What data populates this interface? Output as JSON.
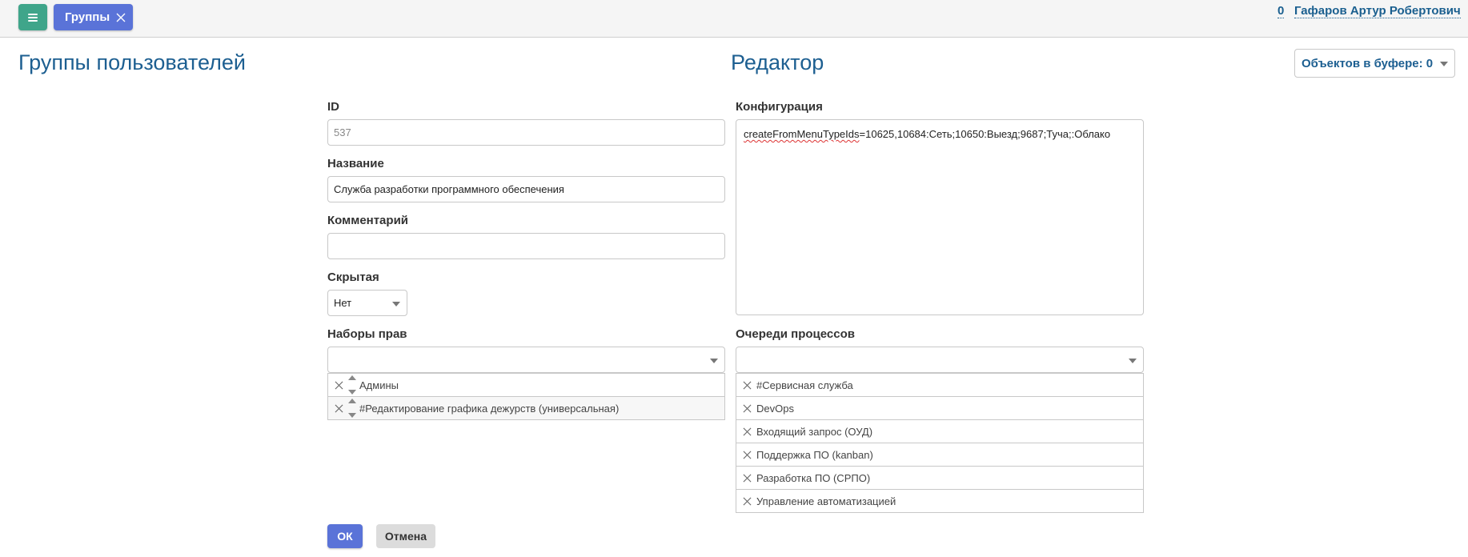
{
  "topbar": {
    "tab_label": "Группы",
    "user_count": "0",
    "user_name": "Гафаров Артур Робертович"
  },
  "titles": {
    "left": "Группы пользователей",
    "right": "Редактор"
  },
  "buffer": {
    "label": "Объектов в буфере: 0"
  },
  "form": {
    "id_label": "ID",
    "id_placeholder": "537",
    "name_label": "Название",
    "name_value": "Служба разработки программного обеспечения",
    "comment_label": "Комментарий",
    "comment_value": "",
    "hidden_label": "Скрытая",
    "hidden_value": "Нет",
    "permsets_label": "Наборы прав",
    "permsets": [
      "Админы",
      "#Редактирование графика дежурств (универсальная)"
    ],
    "config_label": "Конфигурация",
    "config_key": "createFromMenuTypeIds",
    "config_rest": "=10625,10684:Сеть;10650:Выезд;9687;Туча;:Облако",
    "queues_label": "Очереди процессов",
    "queues": [
      "#Сервисная служба",
      "DevOps",
      "Входящий запрос (ОУД)",
      "Поддержка ПО (kanban)",
      "Разработка ПО (СРПО)",
      "Управление автоматизацией"
    ]
  },
  "actions": {
    "ok": "ОК",
    "cancel": "Отмена"
  },
  "colors": {
    "menu_button": "#3fa58a",
    "primary": "#5a73d8",
    "title": "#1d5f91"
  }
}
